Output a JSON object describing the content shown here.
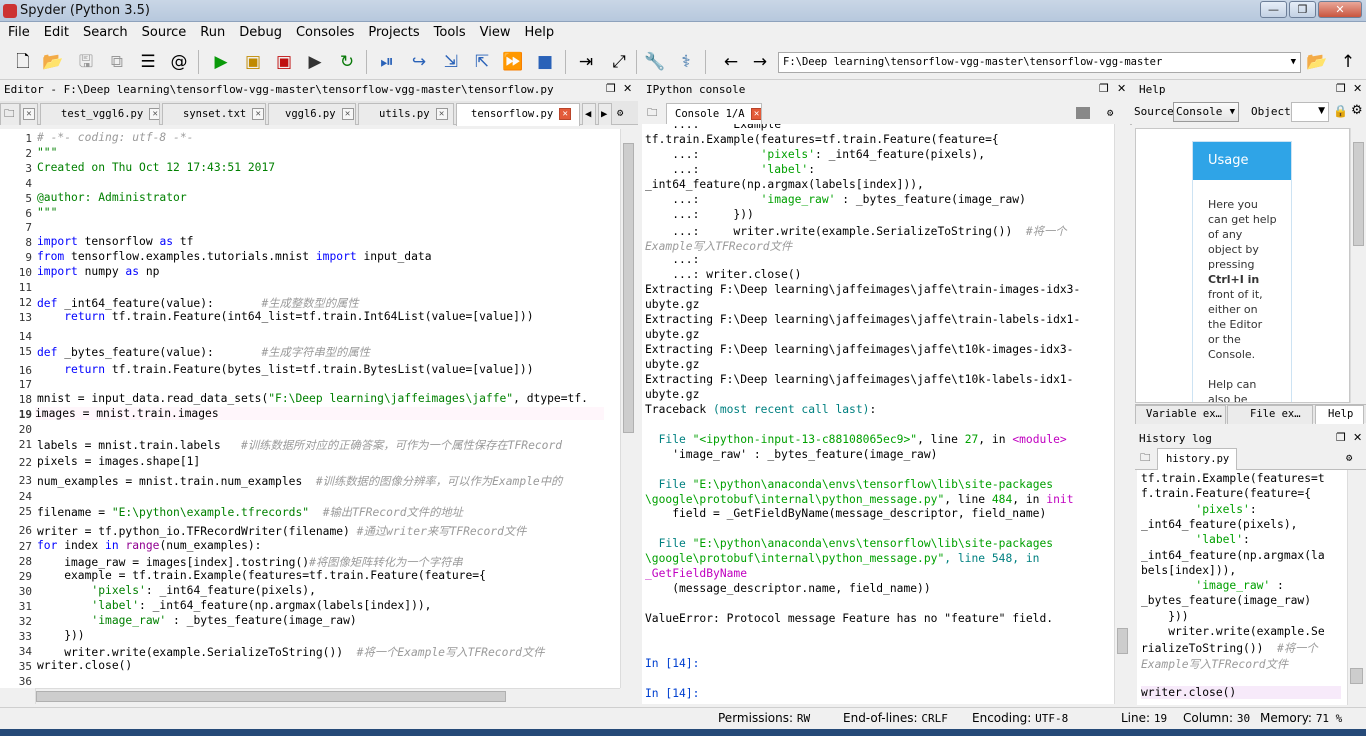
{
  "window": {
    "title": "Spyder (Python 3.5)",
    "min": "—",
    "max": "❐",
    "close": "✕"
  },
  "menu": [
    "File",
    "Edit",
    "Search",
    "Source",
    "Run",
    "Debug",
    "Consoles",
    "Projects",
    "Tools",
    "View",
    "Help"
  ],
  "path": "F:\\Deep learning\\tensorflow-vgg-master\\tensorflow-vgg-master",
  "editor": {
    "title": "Editor - F:\\Deep learning\\tensorflow-vgg-master\\tensorflow-vgg-master\\tensorflow.py",
    "tabs": [
      "test_vggl6.py",
      "synset.txt",
      "vggl6.py",
      "utils.py",
      "tensorflow.py"
    ],
    "line_numbers": [
      "1",
      "2",
      "3",
      "4",
      "5",
      "6",
      "7",
      "8",
      "9",
      "10",
      "11",
      "12",
      "13",
      "14",
      "15",
      "16",
      "17",
      "18",
      "19",
      "20",
      "21",
      "22",
      "23",
      "24",
      "25",
      "26",
      "27",
      "28",
      "29",
      "30",
      "31",
      "32",
      "33",
      "34",
      "35",
      "36"
    ],
    "lines": [
      [
        [
          "c",
          "# -*- coding: utf-8 -*-"
        ]
      ],
      [
        [
          "d",
          "\"\"\""
        ]
      ],
      [
        [
          "d",
          "Created on Thu Oct 12 17:43:51 2017"
        ]
      ],
      [
        [
          "d",
          ""
        ]
      ],
      [
        [
          "d",
          "@author: Administrator"
        ]
      ],
      [
        [
          "d",
          "\"\"\""
        ]
      ],
      [
        [
          "n",
          ""
        ]
      ],
      [
        [
          "k",
          "import"
        ],
        [
          "n",
          " tensorflow "
        ],
        [
          "k",
          "as"
        ],
        [
          "n",
          " tf"
        ]
      ],
      [
        [
          "k",
          "from"
        ],
        [
          "n",
          " tensorflow.examples.tutorials.mnist "
        ],
        [
          "k",
          "import"
        ],
        [
          "n",
          " input_data"
        ]
      ],
      [
        [
          "k",
          "import"
        ],
        [
          "n",
          " numpy "
        ],
        [
          "k",
          "as"
        ],
        [
          "n",
          " np"
        ]
      ],
      [
        [
          "n",
          ""
        ]
      ],
      [
        [
          "k",
          "def"
        ],
        [
          "n",
          " _int64_feature(value):       "
        ],
        [
          "c",
          "#生成整数型的属性"
        ]
      ],
      [
        [
          "n",
          "    "
        ],
        [
          "k",
          "return"
        ],
        [
          "n",
          " tf.train.Feature(int64_list=tf.train.Int64List(value=[value]))"
        ]
      ],
      [
        [
          "n",
          ""
        ]
      ],
      [
        [
          "k",
          "def"
        ],
        [
          "n",
          " _bytes_feature(value):       "
        ],
        [
          "c",
          "#生成字符串型的属性"
        ]
      ],
      [
        [
          "n",
          "    "
        ],
        [
          "k",
          "return"
        ],
        [
          "n",
          " tf.train.Feature(bytes_list=tf.train.BytesList(value=[value]))"
        ]
      ],
      [
        [
          "n",
          ""
        ]
      ],
      [
        [
          "n",
          "mnist = input_data.read_data_sets("
        ],
        [
          "s",
          "\"F:\\Deep learning\\jaffeimages\\jaffe\""
        ],
        [
          "n",
          ", dtype=tf."
        ]
      ],
      [
        [
          "n",
          "images = mnist.train.images "
        ]
      ],
      [
        [
          "n",
          ""
        ]
      ],
      [
        [
          "n",
          "labels = mnist.train.labels   "
        ],
        [
          "c",
          "#训练数据所对应的正确答案，可作为一个属性保存在TFRecord"
        ]
      ],
      [
        [
          "n",
          "pixels = images.shape[1]"
        ]
      ],
      [
        [
          "n",
          "num_examples = mnist.train.num_examples  "
        ],
        [
          "c",
          "#训练数据的图像分辨率，可以作为Example中的"
        ]
      ],
      [
        [
          "n",
          ""
        ]
      ],
      [
        [
          "n",
          "filename = "
        ],
        [
          "s",
          "\"E:\\python\\example.tfrecords\""
        ],
        [
          "n",
          "  "
        ],
        [
          "c",
          "#输出TFRecord文件的地址"
        ]
      ],
      [
        [
          "n",
          "writer = tf.python_io.TFRecordWriter(filename) "
        ],
        [
          "c",
          "#通过writer来写TFRecord文件"
        ]
      ],
      [
        [
          "k",
          "for"
        ],
        [
          "n",
          " index "
        ],
        [
          "k",
          "in"
        ],
        [
          "n",
          " "
        ],
        [
          "bi",
          "range"
        ],
        [
          "n",
          "(num_examples):"
        ]
      ],
      [
        [
          "n",
          "    image_raw = images[index].tostring()"
        ],
        [
          "c",
          "#将图像矩阵转化为一个字符串"
        ]
      ],
      [
        [
          "n",
          "    example = tf.train.Example(features=tf.train.Feature(feature={"
        ]
      ],
      [
        [
          "n",
          "        "
        ],
        [
          "s",
          "'pixels'"
        ],
        [
          "n",
          ": _int64_feature(pixels),"
        ]
      ],
      [
        [
          "n",
          "        "
        ],
        [
          "s",
          "'label'"
        ],
        [
          "n",
          ": _int64_feature(np.argmax(labels[index])),"
        ]
      ],
      [
        [
          "n",
          "        "
        ],
        [
          "s",
          "'image_raw'"
        ],
        [
          "n",
          " : _bytes_feature(image_raw)"
        ]
      ],
      [
        [
          "n",
          "    }))"
        ]
      ],
      [
        [
          "n",
          "    writer.write(example.SerializeToString())  "
        ],
        [
          "c",
          "#将一个Example写入TFRecord文件"
        ]
      ],
      [
        [
          "n",
          "writer.close()"
        ]
      ],
      [
        [
          "n",
          ""
        ]
      ]
    ]
  },
  "console": {
    "title": "IPython console",
    "tab": "Console 1/A",
    "lines": [
      [
        [
          "n",
          "    ...:     Example"
        ]
      ],
      [
        [
          "n",
          "tf.train.Example(features=tf.train.Feature(feature={"
        ]
      ],
      [
        [
          "n",
          "    ...:         "
        ],
        [
          "g",
          "'pixels'"
        ],
        [
          "n",
          ": _int64_feature(pixels),"
        ]
      ],
      [
        [
          "n",
          "    ...:         "
        ],
        [
          "g",
          "'label'"
        ],
        [
          "n",
          ":"
        ]
      ],
      [
        [
          "n",
          "_int64_feature(np.argmax(labels[index])),"
        ]
      ],
      [
        [
          "n",
          "    ...:         "
        ],
        [
          "g",
          "'image_raw'"
        ],
        [
          "n",
          " : _bytes_feature(image_raw)"
        ]
      ],
      [
        [
          "n",
          "    ...:     }))"
        ]
      ],
      [
        [
          "n",
          "    ...:     writer.write(example.SerializeToString())  "
        ],
        [
          "gr",
          "#将一个"
        ]
      ],
      [
        [
          "gr",
          "Example写入TFRecord文件"
        ]
      ],
      [
        [
          "n",
          "    ...:"
        ]
      ],
      [
        [
          "n",
          "    ...: writer.close()"
        ]
      ],
      [
        [
          "n",
          "Extracting F:\\Deep learning\\jaffeimages\\jaffe\\train-images-idx3-"
        ]
      ],
      [
        [
          "n",
          "ubyte.gz"
        ]
      ],
      [
        [
          "n",
          "Extracting F:\\Deep learning\\jaffeimages\\jaffe\\train-labels-idx1-"
        ]
      ],
      [
        [
          "n",
          "ubyte.gz"
        ]
      ],
      [
        [
          "n",
          "Extracting F:\\Deep learning\\jaffeimages\\jaffe\\t10k-images-idx3-"
        ]
      ],
      [
        [
          "n",
          "ubyte.gz"
        ]
      ],
      [
        [
          "n",
          "Extracting F:\\Deep learning\\jaffeimages\\jaffe\\t10k-labels-idx1-"
        ]
      ],
      [
        [
          "n",
          "ubyte.gz"
        ]
      ],
      [
        [
          "n",
          "Traceback "
        ],
        [
          "cy",
          "(most recent call last)"
        ],
        [
          "n",
          ":"
        ]
      ],
      [
        [
          "n",
          ""
        ]
      ],
      [
        [
          "n",
          "  "
        ],
        [
          "cy",
          "File "
        ],
        [
          "g",
          "\"<ipython-input-13-c88108065ec9>\""
        ],
        [
          "n",
          ", line "
        ],
        [
          "g",
          "27"
        ],
        [
          "n",
          ", in "
        ],
        [
          "pk",
          "<module>"
        ]
      ],
      [
        [
          "n",
          "    'image_raw' : _bytes_feature(image_raw)"
        ]
      ],
      [
        [
          "n",
          ""
        ]
      ],
      [
        [
          "n",
          "  "
        ],
        [
          "cy",
          "File "
        ],
        [
          "g",
          "\"E:\\python\\anaconda\\envs\\tensorflow\\lib\\site-packages"
        ]
      ],
      [
        [
          "g",
          "\\google\\protobuf\\internal\\python_message.py\""
        ],
        [
          "n",
          ", line "
        ],
        [
          "g",
          "484"
        ],
        [
          "n",
          ", in "
        ],
        [
          "pk",
          "init"
        ]
      ],
      [
        [
          "n",
          "    field = _GetFieldByName(message_descriptor, field_name)"
        ]
      ],
      [
        [
          "n",
          ""
        ]
      ],
      [
        [
          "n",
          "  "
        ],
        [
          "cy",
          "File "
        ],
        [
          "g",
          "\"E:\\python\\anaconda\\envs\\tensorflow\\lib\\site-packages"
        ]
      ],
      [
        [
          "g",
          "\\google\\protobuf\\internal\\python_message.py\""
        ],
        [
          "cy",
          ", line 548, in"
        ]
      ],
      [
        [
          "pk",
          "_GetFieldByName"
        ]
      ],
      [
        [
          "n",
          "    (message_descriptor.name, field_name))"
        ]
      ],
      [
        [
          "n",
          ""
        ]
      ],
      [
        [
          "n",
          "ValueError: Protocol message Feature has no \"feature\" field."
        ]
      ],
      [
        [
          "n",
          ""
        ]
      ],
      [
        [
          "n",
          ""
        ]
      ],
      [
        [
          "bl",
          "In [14]:"
        ]
      ],
      [
        [
          "n",
          ""
        ]
      ],
      [
        [
          "bl",
          "In [14]:"
        ]
      ]
    ]
  },
  "help": {
    "title": "Help",
    "source_label": "Source",
    "source_value": "Console",
    "object_label": "Object",
    "usage_title": "Usage",
    "usage_lines": [
      "Here you",
      "can get help",
      "of any",
      "object by",
      "pressing",
      "Ctrl+I in",
      "front of it,",
      "either on",
      "the Editor",
      "or the",
      "Console.",
      "",
      "Help can",
      "also be"
    ],
    "tabs": [
      "Variable ex…",
      "File ex…",
      "Help"
    ]
  },
  "history": {
    "title": "History log",
    "tab": "history.py",
    "lines": [
      [
        [
          "n",
          "tf.train.Example(features=t"
        ]
      ],
      [
        [
          "n",
          "f.train.Feature(feature={"
        ]
      ],
      [
        [
          "n",
          "        "
        ],
        [
          "g",
          "'pixels'"
        ],
        [
          "n",
          ":"
        ]
      ],
      [
        [
          "n",
          "_int64_feature(pixels),"
        ]
      ],
      [
        [
          "n",
          "        "
        ],
        [
          "g",
          "'label'"
        ],
        [
          "n",
          ":"
        ]
      ],
      [
        [
          "n",
          "_int64_feature(np.argmax(la"
        ]
      ],
      [
        [
          "n",
          "bels[index])),"
        ]
      ],
      [
        [
          "n",
          "        "
        ],
        [
          "g",
          "'image_raw'"
        ],
        [
          "n",
          " :"
        ]
      ],
      [
        [
          "n",
          "_bytes_feature(image_raw)"
        ]
      ],
      [
        [
          "n",
          "    }))"
        ]
      ],
      [
        [
          "n",
          "    writer.write(example.Se"
        ]
      ],
      [
        [
          "n",
          "rializeToString())  "
        ],
        [
          "gr",
          "#将一个"
        ]
      ],
      [
        [
          "gr",
          "Example写入TFRecord文件"
        ]
      ],
      [
        [
          "n",
          ""
        ]
      ],
      [
        [
          "n",
          "writer.close()"
        ]
      ]
    ]
  },
  "status": {
    "permissions_label": "Permissions:",
    "permissions": "RW",
    "eol_label": "End-of-lines:",
    "eol": "CRLF",
    "encoding_label": "Encoding:",
    "encoding": "UTF-8",
    "line_label": "Line:",
    "line": "19",
    "column_label": "Column:",
    "column": "30",
    "memory_label": "Memory:",
    "memory": "71 %"
  },
  "colors": {
    "keyword": "#0000ff",
    "string": "#008000",
    "comment": "#9a9a9a",
    "console_green": "#00a000",
    "prompt": "#0040d0",
    "usage_header": "#2fa4e7"
  },
  "toolbar_icons": [
    "new-file-icon",
    "open-folder-icon",
    "save-icon",
    "save-all-icon",
    "list-icon",
    "at-icon",
    "run-icon",
    "run-cell-icon",
    "run-cell-advance-icon",
    "run-selection-icon",
    "rerun-icon",
    "debug-icon",
    "step-icon",
    "step-into-icon",
    "step-return-icon",
    "continue-icon",
    "stop-icon",
    "maximize-pane-icon",
    "fullscreen-icon",
    "preferences-icon",
    "python-path-icon",
    "back-icon",
    "forward-icon",
    "browse-folder-icon",
    "parent-dir-icon"
  ]
}
